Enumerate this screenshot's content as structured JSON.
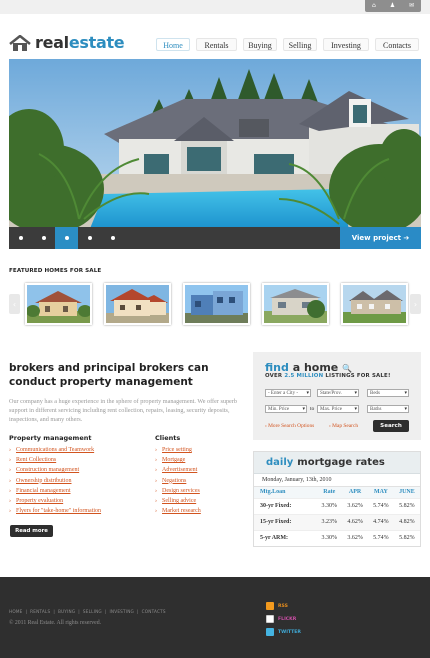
{
  "header": {
    "logo_prefix": "real",
    "logo_suffix": "estate",
    "top_icons": [
      "home-icon",
      "user-icon",
      "mail-icon"
    ]
  },
  "nav": [
    {
      "label": "Home",
      "active": true
    },
    {
      "label": "Rentals",
      "active": false
    },
    {
      "label": "Buying",
      "active": false
    },
    {
      "label": "Selling",
      "active": false
    },
    {
      "label": "Investing",
      "active": false
    },
    {
      "label": "Contacts",
      "active": false
    }
  ],
  "slider": {
    "active_slide": 3,
    "slide_count": 5,
    "view_button": "View project ➔"
  },
  "featured": {
    "title": "FEATURED HOMES FOR SALE",
    "thumbs": 5
  },
  "intro": {
    "headline": "brokers and principal brokers can conduct property management",
    "paragraph": "Our company has a huge experience in the sphere of property management. We offer superb support in different servicing including rent collection, repairs, leasing, security deposits, inspections, and many others."
  },
  "property_management": {
    "title": "Property management",
    "items": [
      "Communications and Teamwork",
      "Rent Collections",
      "Construction management",
      "Ownership distribution",
      "Financial management",
      "Property evaluation",
      "Flyers for \"take-home\" information"
    ]
  },
  "clients": {
    "title": "Clients",
    "items": [
      "Price setting",
      "Mortgage",
      "Advertisement",
      "Negations",
      "Design services",
      "Selling advice",
      "Market research"
    ]
  },
  "read_more": "Read more",
  "find": {
    "title_a": "find",
    "title_b": "a home",
    "subtitle_pre": "OVER",
    "subtitle_highlight": "2.5 MILLION",
    "subtitle_post": "LISTINGS FOR SALE!",
    "city": "- Enter a City -",
    "state": "State/Prov.",
    "beds": "Beds",
    "min_price": "Min. Price",
    "to": "to",
    "max_price": "Max. Price",
    "baths": "Baths",
    "more_options": "› More Search Options",
    "map_search": "› Map Search",
    "search_button": "Search"
  },
  "mortgage": {
    "title_a": "daily",
    "title_b": "mortgage rates",
    "date": "Monday, January, 13th, 2010",
    "columns": [
      "Mtg.Loan",
      "Rate",
      "APR",
      "MAY",
      "JUNE"
    ],
    "rows": [
      [
        "30-yr Fixed:",
        "3.30%",
        "3.62%",
        "5.74%",
        "5.82%"
      ],
      [
        "15-yr Fixed:",
        "3.23%",
        "4.62%",
        "4.74%",
        "4.82%"
      ],
      [
        "5-yr ARM:",
        "3.30%",
        "3.62%",
        "5.74%",
        "5.82%"
      ]
    ]
  },
  "footer": {
    "nav": [
      "HOME",
      "|",
      "RENTALS",
      "|",
      "BUYING",
      "|",
      "SELLING",
      "|",
      "INVESTING",
      "|",
      "CONTACTS"
    ],
    "copyright": "© 2011 Real Estate. All rights reserved.",
    "rss": "RSS",
    "flickr": "FLICKR",
    "twitter": "TWITTER"
  },
  "colors": {
    "accent": "#2d8dbf",
    "link": "#d2541f",
    "footer": "#2f2f2f"
  }
}
